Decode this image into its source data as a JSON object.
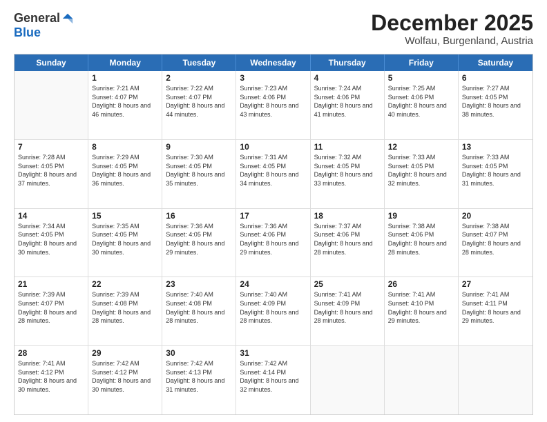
{
  "header": {
    "logo_general": "General",
    "logo_blue": "Blue",
    "month_title": "December 2025",
    "location": "Wolfau, Burgenland, Austria"
  },
  "calendar": {
    "days_of_week": [
      "Sunday",
      "Monday",
      "Tuesday",
      "Wednesday",
      "Thursday",
      "Friday",
      "Saturday"
    ],
    "weeks": [
      [
        {
          "day": "",
          "empty": true
        },
        {
          "day": "1",
          "sunrise": "7:21 AM",
          "sunset": "4:07 PM",
          "daylight": "8 hours and 46 minutes."
        },
        {
          "day": "2",
          "sunrise": "7:22 AM",
          "sunset": "4:07 PM",
          "daylight": "8 hours and 44 minutes."
        },
        {
          "day": "3",
          "sunrise": "7:23 AM",
          "sunset": "4:06 PM",
          "daylight": "8 hours and 43 minutes."
        },
        {
          "day": "4",
          "sunrise": "7:24 AM",
          "sunset": "4:06 PM",
          "daylight": "8 hours and 41 minutes."
        },
        {
          "day": "5",
          "sunrise": "7:25 AM",
          "sunset": "4:06 PM",
          "daylight": "8 hours and 40 minutes."
        },
        {
          "day": "6",
          "sunrise": "7:27 AM",
          "sunset": "4:05 PM",
          "daylight": "8 hours and 38 minutes."
        }
      ],
      [
        {
          "day": "7",
          "sunrise": "7:28 AM",
          "sunset": "4:05 PM",
          "daylight": "8 hours and 37 minutes."
        },
        {
          "day": "8",
          "sunrise": "7:29 AM",
          "sunset": "4:05 PM",
          "daylight": "8 hours and 36 minutes."
        },
        {
          "day": "9",
          "sunrise": "7:30 AM",
          "sunset": "4:05 PM",
          "daylight": "8 hours and 35 minutes."
        },
        {
          "day": "10",
          "sunrise": "7:31 AM",
          "sunset": "4:05 PM",
          "daylight": "8 hours and 34 minutes."
        },
        {
          "day": "11",
          "sunrise": "7:32 AM",
          "sunset": "4:05 PM",
          "daylight": "8 hours and 33 minutes."
        },
        {
          "day": "12",
          "sunrise": "7:33 AM",
          "sunset": "4:05 PM",
          "daylight": "8 hours and 32 minutes."
        },
        {
          "day": "13",
          "sunrise": "7:33 AM",
          "sunset": "4:05 PM",
          "daylight": "8 hours and 31 minutes."
        }
      ],
      [
        {
          "day": "14",
          "sunrise": "7:34 AM",
          "sunset": "4:05 PM",
          "daylight": "8 hours and 30 minutes."
        },
        {
          "day": "15",
          "sunrise": "7:35 AM",
          "sunset": "4:05 PM",
          "daylight": "8 hours and 30 minutes."
        },
        {
          "day": "16",
          "sunrise": "7:36 AM",
          "sunset": "4:05 PM",
          "daylight": "8 hours and 29 minutes."
        },
        {
          "day": "17",
          "sunrise": "7:36 AM",
          "sunset": "4:06 PM",
          "daylight": "8 hours and 29 minutes."
        },
        {
          "day": "18",
          "sunrise": "7:37 AM",
          "sunset": "4:06 PM",
          "daylight": "8 hours and 28 minutes."
        },
        {
          "day": "19",
          "sunrise": "7:38 AM",
          "sunset": "4:06 PM",
          "daylight": "8 hours and 28 minutes."
        },
        {
          "day": "20",
          "sunrise": "7:38 AM",
          "sunset": "4:07 PM",
          "daylight": "8 hours and 28 minutes."
        }
      ],
      [
        {
          "day": "21",
          "sunrise": "7:39 AM",
          "sunset": "4:07 PM",
          "daylight": "8 hours and 28 minutes."
        },
        {
          "day": "22",
          "sunrise": "7:39 AM",
          "sunset": "4:08 PM",
          "daylight": "8 hours and 28 minutes."
        },
        {
          "day": "23",
          "sunrise": "7:40 AM",
          "sunset": "4:08 PM",
          "daylight": "8 hours and 28 minutes."
        },
        {
          "day": "24",
          "sunrise": "7:40 AM",
          "sunset": "4:09 PM",
          "daylight": "8 hours and 28 minutes."
        },
        {
          "day": "25",
          "sunrise": "7:41 AM",
          "sunset": "4:09 PM",
          "daylight": "8 hours and 28 minutes."
        },
        {
          "day": "26",
          "sunrise": "7:41 AM",
          "sunset": "4:10 PM",
          "daylight": "8 hours and 29 minutes."
        },
        {
          "day": "27",
          "sunrise": "7:41 AM",
          "sunset": "4:11 PM",
          "daylight": "8 hours and 29 minutes."
        }
      ],
      [
        {
          "day": "28",
          "sunrise": "7:41 AM",
          "sunset": "4:12 PM",
          "daylight": "8 hours and 30 minutes."
        },
        {
          "day": "29",
          "sunrise": "7:42 AM",
          "sunset": "4:12 PM",
          "daylight": "8 hours and 30 minutes."
        },
        {
          "day": "30",
          "sunrise": "7:42 AM",
          "sunset": "4:13 PM",
          "daylight": "8 hours and 31 minutes."
        },
        {
          "day": "31",
          "sunrise": "7:42 AM",
          "sunset": "4:14 PM",
          "daylight": "8 hours and 32 minutes."
        },
        {
          "day": "",
          "empty": true
        },
        {
          "day": "",
          "empty": true
        },
        {
          "day": "",
          "empty": true
        }
      ]
    ]
  }
}
